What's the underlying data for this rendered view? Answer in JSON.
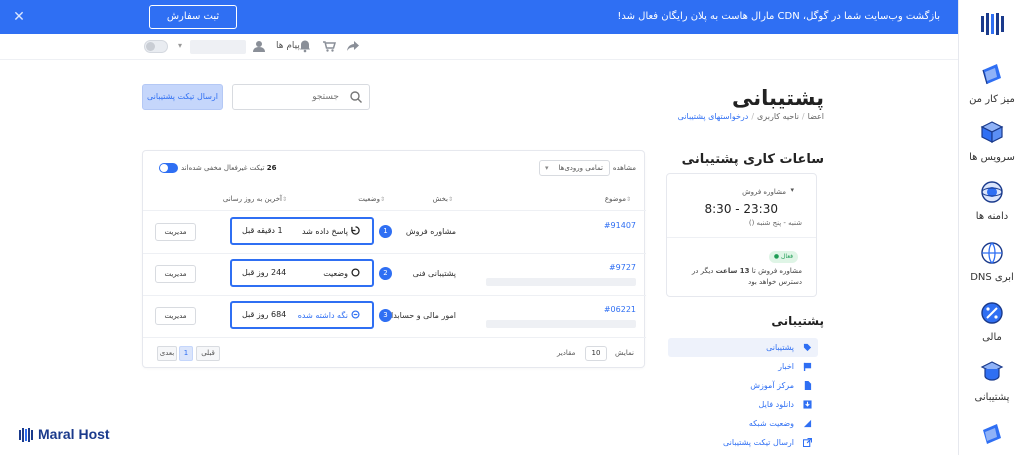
{
  "banner": {
    "message": "بازگشت وب‌سایت شما در گوگل، CDN مارال هاست به پلان رایگان فعال شد!",
    "order_button": "ثبت سفارش",
    "color": "#2f6ff3"
  },
  "toolbar": {
    "messages_label": "پیام ها",
    "toggle_label": "ON"
  },
  "page": {
    "title": "پشتیبانی",
    "breadcrumb": [
      "اعضا",
      "ناحیه کاربری",
      "درخواستهای پشتیبانی"
    ]
  },
  "search": {
    "placeholder": "جستجو"
  },
  "send_ticket_button": "ارسال تیکت پشتیبانی",
  "hours": {
    "title": "ساعات کاری پشتیبانی",
    "department": "مشاوره فروش",
    "time": "8:30 - 23:30",
    "days": "شنبه - پنج شنبه ()",
    "badge": "فعال",
    "note_pre": "مشاوره فروش تا ",
    "note_bold": "13 ساعت",
    "note_post": " دیگر در دسترس خواهد بود"
  },
  "support_menu": {
    "title": "پشتیبانی",
    "items": [
      {
        "label": "پشتیبانی",
        "icon": "tag-icon"
      },
      {
        "label": "اخبار",
        "icon": "flag-icon"
      },
      {
        "label": "مرکز آموزش",
        "icon": "file-icon"
      },
      {
        "label": "دانلود فایل",
        "icon": "download-icon"
      },
      {
        "label": "وضعیت شبکه",
        "icon": "signal-icon"
      },
      {
        "label": "ارسال تیکت پشتیبانی",
        "icon": "external-link-icon"
      }
    ]
  },
  "tickets": {
    "view_label": "مشاهده",
    "view_value": "تمامی ورودی‌ها",
    "hidden_count": "26",
    "hidden_text": " تیکت غیرفعال مخفی شده‌اند",
    "columns": [
      "موضوع",
      "بخش",
      "وضعیت",
      "آخرین به روز رسانی"
    ],
    "rows": [
      {
        "num": "1",
        "id": "#91407",
        "dept": "مشاوره فروش",
        "status": "پاسخ داده شد",
        "updated": "1 دقیقه قبل",
        "manage": "مدیریت"
      },
      {
        "num": "2",
        "id": "#9727",
        "dept": "پشتیبانی فنی",
        "status": "وضعیت",
        "updated": "244 روز قبل",
        "manage": "مدیریت"
      },
      {
        "num": "3",
        "id": "#06221",
        "dept": "امور مالی و حسابداری",
        "status": "نگه داشته شده",
        "updated": "684 روز قبل",
        "manage": "مدیریت"
      }
    ],
    "footer": {
      "show": "نمایش",
      "per_page": "10",
      "items": "مقادیر",
      "prev": "قبلی",
      "page": "1",
      "next": "بعدی"
    }
  },
  "nav": {
    "items": [
      "میز کار من",
      "سرویس ها",
      "دامنه ها",
      "DNS ابری",
      "مالی",
      "پشتیبانی"
    ]
  },
  "brand": {
    "name": "Maral Host"
  }
}
